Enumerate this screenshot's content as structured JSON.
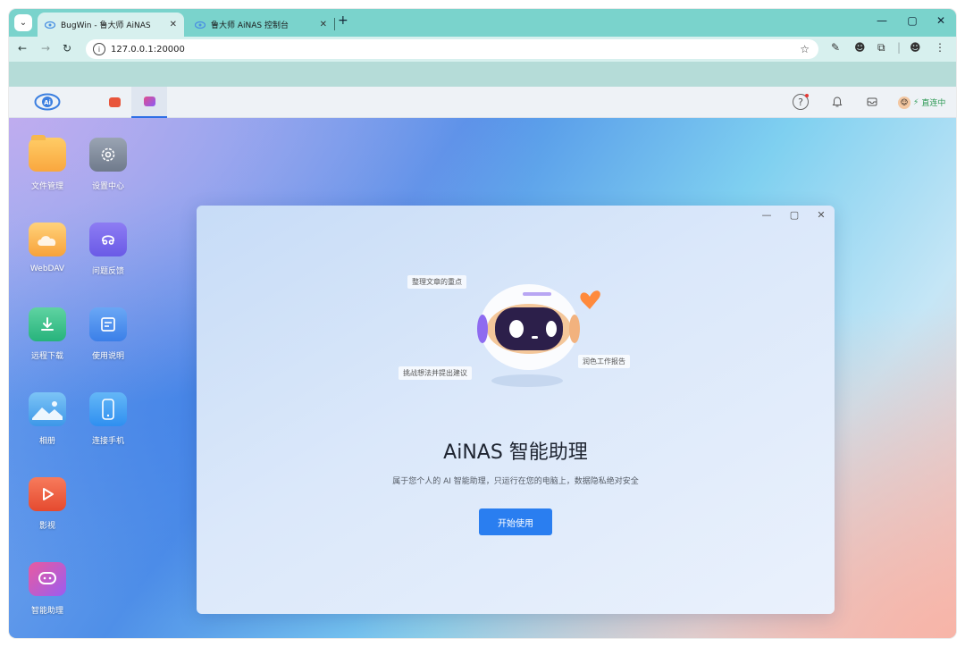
{
  "browser": {
    "tabs": [
      {
        "label": "BugWin - 鲁大师 AiNAS",
        "active": true
      },
      {
        "label": "鲁大师 AiNAS 控制台",
        "active": false
      }
    ],
    "url": "127.0.0.1:20000",
    "accent": "#7ad3cc"
  },
  "appbar": {
    "status_label": "直连中"
  },
  "desktop_icons": [
    {
      "label": "文件管理",
      "icon": "folder-icon"
    },
    {
      "label": "设置中心",
      "icon": "gear-icon"
    },
    {
      "label": "WebDAV",
      "icon": "cloud-folder-icon"
    },
    {
      "label": "问题反馈",
      "icon": "headset-icon"
    },
    {
      "label": "远程下载",
      "icon": "download-icon"
    },
    {
      "label": "使用说明",
      "icon": "document-icon"
    },
    {
      "label": "相册",
      "icon": "photo-icon"
    },
    {
      "label": "连接手机",
      "icon": "phone-icon"
    },
    {
      "label": "影视",
      "icon": "play-icon"
    },
    {
      "label": "智能助理",
      "icon": "chat-icon"
    }
  ],
  "assistant": {
    "bubbles": [
      "整理文章的重点",
      "挑战想法并提出建议",
      "润色工作报告"
    ],
    "title": "AiNAS 智能助理",
    "subtitle": "属于您个人的 AI 智能助理，只运行在您的电脑上，数据隐私绝对安全",
    "start_button": "开始使用",
    "button_color": "#2a7ef0"
  }
}
